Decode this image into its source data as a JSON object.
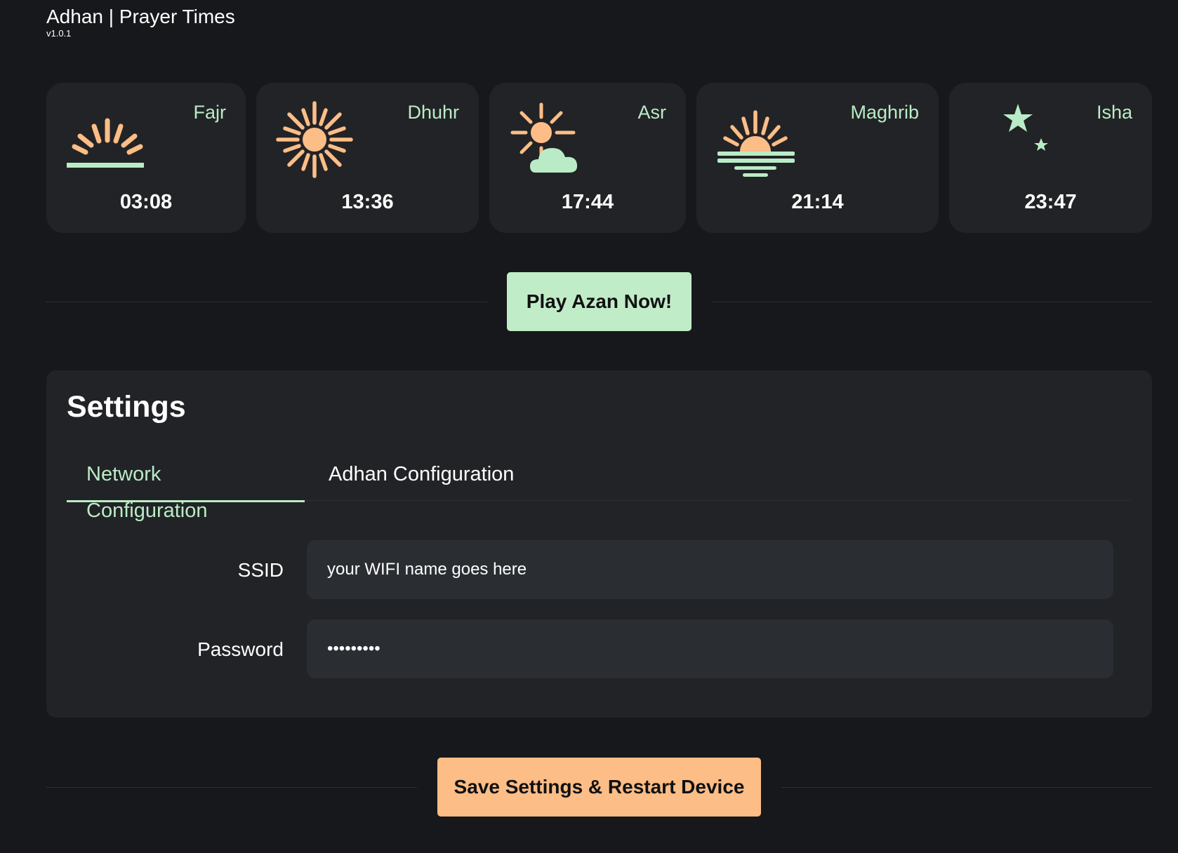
{
  "header": {
    "title": "Adhan | Prayer Times",
    "version": "v1.0.1"
  },
  "prayers": [
    {
      "name": "Fajr",
      "time": "03:08",
      "icon": "sunrise-icon"
    },
    {
      "name": "Dhuhr",
      "time": "13:36",
      "icon": "sun-icon"
    },
    {
      "name": "Asr",
      "time": "17:44",
      "icon": "sun-cloud-icon"
    },
    {
      "name": "Maghrib",
      "time": "21:14",
      "icon": "sunset-icon"
    },
    {
      "name": "Isha",
      "time": "23:47",
      "icon": "moon-stars-icon"
    }
  ],
  "actions": {
    "play_label": "Play Azan Now!",
    "save_label": "Save Settings & Restart Device"
  },
  "settings": {
    "title": "Settings",
    "tabs": [
      {
        "label": "Network Configuration",
        "active": true
      },
      {
        "label": "Adhan Configuration",
        "active": false
      }
    ],
    "network": {
      "ssid_label": "SSID",
      "ssid_value": "your WIFI name goes here",
      "password_label": "Password",
      "password_value": "•••••••••"
    }
  },
  "colors": {
    "accent_green": "#c1ecc8",
    "accent_orange": "#fdbd87",
    "card_bg": "#222326",
    "page_bg": "#17181b"
  }
}
